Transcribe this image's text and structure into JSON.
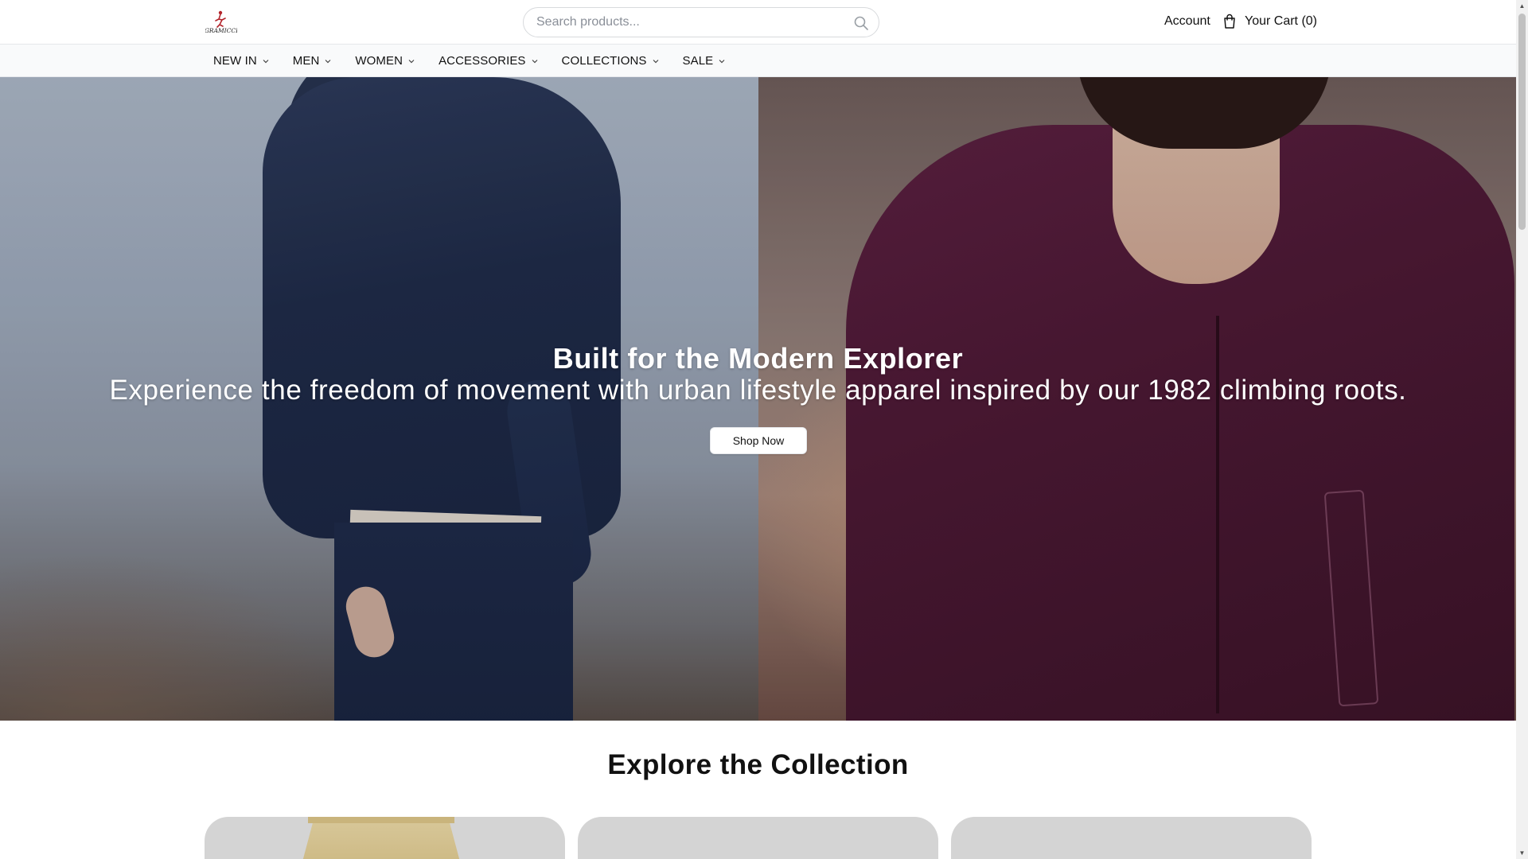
{
  "brand": {
    "logo_text": "GRAMICCI",
    "accent_color": "#b3242b"
  },
  "header": {
    "search": {
      "placeholder": "Search products...",
      "icon": "search-icon"
    },
    "account_label": "Account",
    "cart_label": "Your Cart (0)",
    "cart_icon": "shopping-bag-icon"
  },
  "nav": {
    "items": [
      {
        "label": "NEW IN"
      },
      {
        "label": "MEN"
      },
      {
        "label": "WOMEN"
      },
      {
        "label": "ACCESSORIES"
      },
      {
        "label": "COLLECTIONS"
      },
      {
        "label": "SALE"
      }
    ]
  },
  "hero": {
    "title": "Built for the Modern Explorer",
    "subtitle": "Experience the freedom of movement with urban lifestyle apparel inspired by our 1982 climbing roots.",
    "cta_label": "Shop Now"
  },
  "collection": {
    "title": "Explore the Collection"
  },
  "colors": {
    "border": "#e5e7eb",
    "nav_bg": "#f9fafb",
    "card_bg": "#d4d4d4"
  }
}
